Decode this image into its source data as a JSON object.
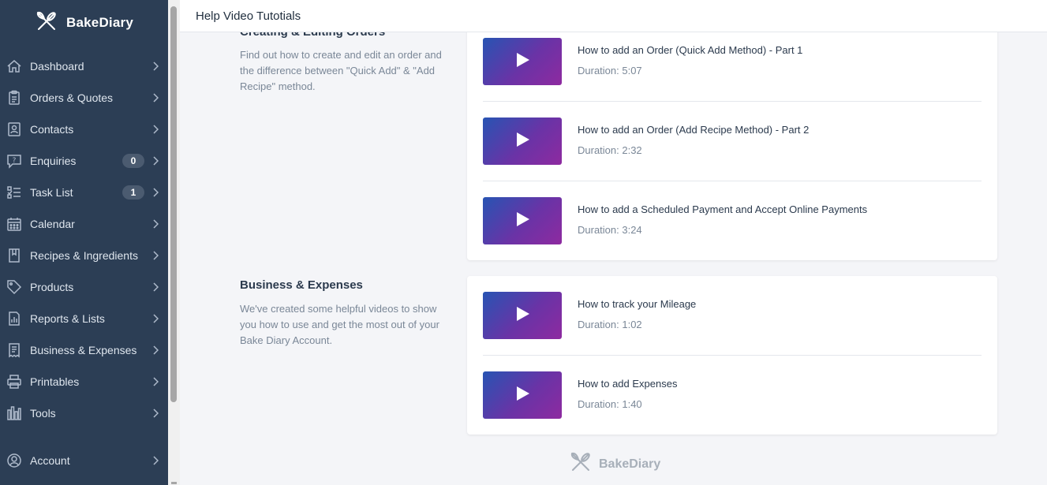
{
  "app": {
    "name": "BakeDiary"
  },
  "header": {
    "title": "Help Video Tutotials"
  },
  "sidebar": {
    "items": [
      {
        "label": "Dashboard",
        "icon": "home-icon"
      },
      {
        "label": "Orders & Quotes",
        "icon": "clipboard-icon"
      },
      {
        "label": "Contacts",
        "icon": "contact-card-icon"
      },
      {
        "label": "Enquiries",
        "icon": "question-chat-icon",
        "badge": "0"
      },
      {
        "label": "Task List",
        "icon": "checklist-icon",
        "badge": "1"
      },
      {
        "label": "Calendar",
        "icon": "calendar-icon"
      },
      {
        "label": "Recipes & Ingredients",
        "icon": "recipe-book-icon"
      },
      {
        "label": "Products",
        "icon": "tag-icon"
      },
      {
        "label": "Reports & Lists",
        "icon": "report-icon"
      },
      {
        "label": "Business & Expenses",
        "icon": "receipt-icon"
      },
      {
        "label": "Printables",
        "icon": "printer-icon"
      },
      {
        "label": "Tools",
        "icon": "tools-icon"
      },
      {
        "label": "Account",
        "icon": "user-circle-icon"
      }
    ]
  },
  "sections": [
    {
      "title": "Creating & Editing Orders",
      "description": "Find out how to create and edit an order and the difference between \"Quick Add\" & \"Add Recipe\" method.",
      "videos": [
        {
          "title": "How to add an Order (Quick Add Method) - Part 1",
          "duration": "Duration: 5:07"
        },
        {
          "title": "How to add an Order (Add Recipe Method) - Part 2",
          "duration": "Duration: 2:32"
        },
        {
          "title": "How to add a Scheduled Payment and Accept Online Payments",
          "duration": "Duration: 3:24"
        }
      ]
    },
    {
      "title": "Business & Expenses",
      "description": "We've created some helpful videos to show you how to use and get the most out of your Bake Diary Account.",
      "videos": [
        {
          "title": "How to track your Mileage",
          "duration": "Duration: 1:02"
        },
        {
          "title": "How to add Expenses",
          "duration": "Duration: 1:40"
        }
      ]
    }
  ],
  "footer": {
    "brand": "BakeDiary"
  },
  "colors": {
    "sidebar_bg": "#2c3e55",
    "badge_bg": "#4b5b70",
    "thumb_gradient_start": "#2754b3",
    "thumb_gradient_end": "#8e2aa0",
    "page_bg": "#f4f5f8"
  }
}
